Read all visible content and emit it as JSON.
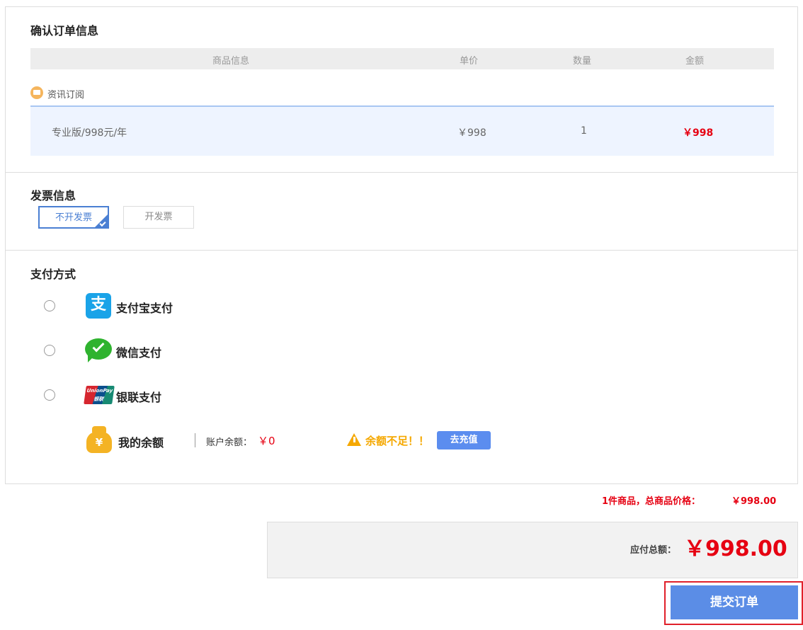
{
  "order": {
    "title": "确认订单信息",
    "columns": [
      "商品信息",
      "单价",
      "数量",
      "金额"
    ],
    "shop_name": "资讯订阅",
    "item": {
      "name": "专业版/998元/年",
      "price": "￥998",
      "qty": "1",
      "amount": "￥998"
    }
  },
  "invoice": {
    "title": "发票信息",
    "options": [
      "不开发票",
      "开发票"
    ],
    "selected": "不开发票"
  },
  "payment": {
    "title": "支付方式",
    "methods": [
      "支付宝支付",
      "微信支付",
      "银联支付"
    ],
    "unionpay_logo_text": "UnionPay 银联",
    "balance": {
      "label": "我的余额",
      "account_label": "账户余额：",
      "value": "￥0",
      "warning": "余额不足！！",
      "recharge": "去充值"
    }
  },
  "summary": {
    "count_text": "1件商品，总商品价格：",
    "goods_total": "￥998.00",
    "payable_label": "应付总额：",
    "payable": "￥998.00",
    "submit": "提交订单"
  },
  "colors": {
    "accent": "#5b8de6",
    "price_red": "#e60012",
    "warning": "#f5a800"
  }
}
